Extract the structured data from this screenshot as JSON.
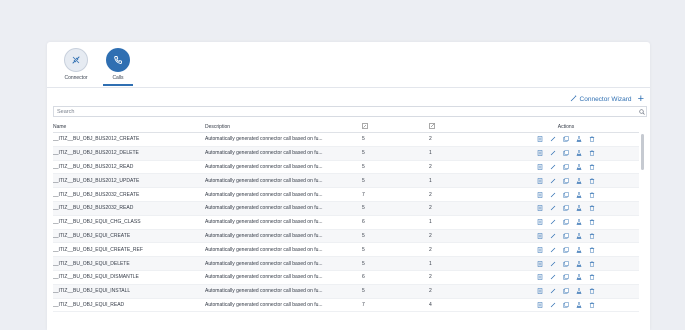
{
  "tabs": [
    {
      "label": "Connector"
    },
    {
      "label": "Calls"
    }
  ],
  "toolbar": {
    "wizard_label": "Connector Wizard",
    "add_label": "+"
  },
  "search": {
    "placeholder": "Search"
  },
  "table": {
    "headers": {
      "name": "Name",
      "description": "Description",
      "actions": "Actions"
    },
    "rows": [
      {
        "name": "__ITIZ__BU_OBJ_BUS2012_CREATE",
        "description": "Automatically generated connector call based on fu...",
        "a": "5",
        "b": "2"
      },
      {
        "name": "__ITIZ__BU_OBJ_BUS2012_DELETE",
        "description": "Automatically generated connector call based on fu...",
        "a": "5",
        "b": "1"
      },
      {
        "name": "__ITIZ__BU_OBJ_BUS2012_READ",
        "description": "Automatically generated connector call based on fu...",
        "a": "5",
        "b": "2"
      },
      {
        "name": "__ITIZ__BU_OBJ_BUS2012_UPDATE",
        "description": "Automatically generated connector call based on fu...",
        "a": "5",
        "b": "1"
      },
      {
        "name": "__ITIZ__BU_OBJ_BUS2032_CREATE",
        "description": "Automatically generated connector call based on fu...",
        "a": "7",
        "b": "2"
      },
      {
        "name": "__ITIZ__BU_OBJ_BUS2032_READ",
        "description": "Automatically generated connector call based on fu...",
        "a": "5",
        "b": "2"
      },
      {
        "name": "__ITIZ__BU_OBJ_EQUI_CHG_CLASS",
        "description": "Automatically generated connector call based on fu...",
        "a": "6",
        "b": "1"
      },
      {
        "name": "__ITIZ__BU_OBJ_EQUI_CREATE",
        "description": "Automatically generated connector call based on fu...",
        "a": "5",
        "b": "2"
      },
      {
        "name": "__ITIZ__BU_OBJ_EQUI_CREATE_REF",
        "description": "Automatically generated connector call based on fu...",
        "a": "5",
        "b": "2"
      },
      {
        "name": "__ITIZ__BU_OBJ_EQUI_DELETE",
        "description": "Automatically generated connector call based on fu...",
        "a": "5",
        "b": "1"
      },
      {
        "name": "__ITIZ__BU_OBJ_EQUI_DISMANTLE",
        "description": "Automatically generated connector call based on fu...",
        "a": "6",
        "b": "2"
      },
      {
        "name": "__ITIZ__BU_OBJ_EQUI_INSTALL",
        "description": "Automatically generated connector call based on fu...",
        "a": "5",
        "b": "2"
      },
      {
        "name": "__ITIZ__BU_OBJ_EQUI_READ",
        "description": "Automatically generated connector call based on fu...",
        "a": "7",
        "b": "4"
      }
    ]
  },
  "colors": {
    "accent": "#2f6fb2",
    "background": "#eceef3",
    "panel": "#ffffff"
  },
  "icons": {
    "connector_tab": "connector-plug-icon",
    "calls_tab": "phone-icon",
    "wizard": "magic-wand-icon",
    "add": "plus-icon",
    "search": "search-icon",
    "col_input": "input-params-icon",
    "col_output": "output-params-icon",
    "actions": [
      "document-icon",
      "edit-pencil-icon",
      "copy-icon",
      "flask-test-icon",
      "trash-icon"
    ]
  }
}
